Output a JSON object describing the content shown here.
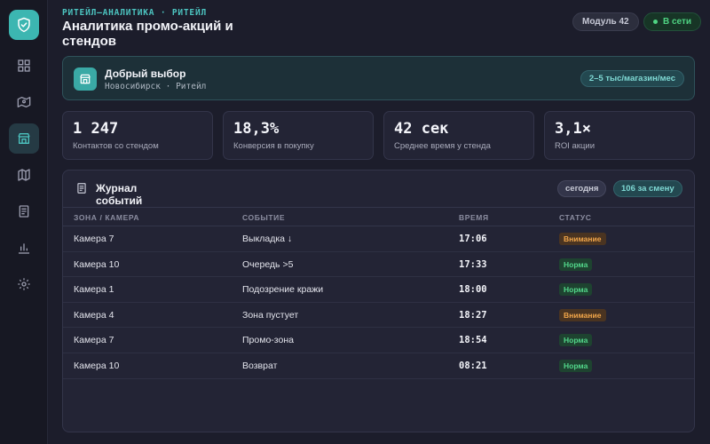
{
  "header": {
    "eyebrow": "РИТЕЙЛ—АНАЛИТИКА · РИТЕЙЛ",
    "title": "Аналитика промо-акций и стендов",
    "module": "Модуль 42",
    "online": "В сети"
  },
  "sidebar": {
    "items": [
      {
        "name": "dashboard-icon"
      },
      {
        "name": "map-route-icon"
      },
      {
        "name": "store-icon",
        "active": true
      },
      {
        "name": "map-icon"
      },
      {
        "name": "document-icon"
      },
      {
        "name": "bar-chart-icon"
      },
      {
        "name": "gear-icon"
      }
    ]
  },
  "store": {
    "name": "Добрый выбор",
    "subtitle": "Новосибирск · Ритейл",
    "traffic": "2–5 тыс/магазин/мес"
  },
  "kpis": [
    {
      "value": "1 247",
      "label": "Контактов со стендом"
    },
    {
      "value": "18,3%",
      "label": "Конверсия в покупку"
    },
    {
      "value": "42 сек",
      "label": "Среднее время у стенда"
    },
    {
      "value": "3,1×",
      "label": "ROI акции"
    }
  ],
  "journal": {
    "title": "Журнал событий",
    "today": "сегодня",
    "shift_count": "106 за смену",
    "columns": [
      "ЗОНА / КАМЕРА",
      "СОБЫТИЕ",
      "ВРЕМЯ",
      "СТАТУС"
    ],
    "rows": [
      {
        "zone": "Камера 7",
        "event": "Выкладка ↓",
        "time": "17:06",
        "status": "Внимание",
        "level": "warn"
      },
      {
        "zone": "Камера 10",
        "event": "Очередь >5",
        "time": "17:33",
        "status": "Норма",
        "level": "ok"
      },
      {
        "zone": "Камера 1",
        "event": "Подозрение кражи",
        "time": "18:00",
        "status": "Норма",
        "level": "ok"
      },
      {
        "zone": "Камера 4",
        "event": "Зона пустует",
        "time": "18:27",
        "status": "Внимание",
        "level": "warn"
      },
      {
        "zone": "Камера 7",
        "event": "Промо-зона",
        "time": "18:54",
        "status": "Норма",
        "level": "ok"
      },
      {
        "zone": "Камера 10",
        "event": "Возврат",
        "time": "08:21",
        "status": "Норма",
        "level": "ok"
      }
    ]
  },
  "colors": {
    "accent": "#3cb6b1",
    "ok": "#52d78a",
    "warn": "#f2a64a",
    "background": "#1c1d2b"
  }
}
